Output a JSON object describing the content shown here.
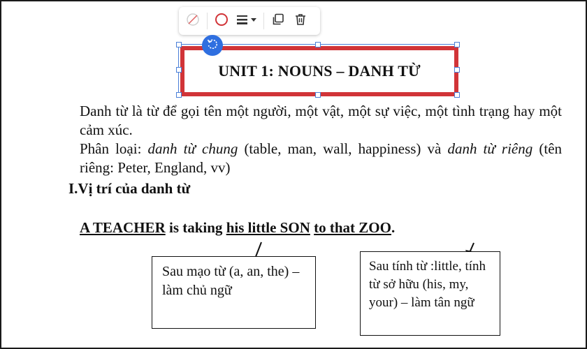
{
  "toolbar": {
    "items": [
      {
        "name": "no-fill-icon"
      },
      {
        "name": "border-color-icon",
        "color": "#d13438"
      },
      {
        "name": "line-style-icon"
      },
      {
        "name": "duplicate-icon"
      },
      {
        "name": "delete-icon"
      }
    ]
  },
  "colors": {
    "accent": "#2f6fe0",
    "shape_border": "#d13438",
    "selection": "#4a7fd8"
  },
  "title_box": {
    "text": "UNIT 1: NOUNS – DANH TỪ"
  },
  "definition": {
    "line1": "Danh từ là từ để gọi tên một người, một vật, một sự việc, một tình trạng hay một cảm xúc.",
    "classify_prefix": "Phân loại: ",
    "classify_common": "danh từ chung",
    "classify_mid": " (table, man, wall, happiness) và ",
    "classify_proper": "danh từ riêng",
    "classify_suffix": " (tên riêng: Peter, England, vv)"
  },
  "section_heading": "I.Vị trí của danh từ",
  "example": {
    "part1": "A TEACHER",
    "part2": " is taking ",
    "part3": "his little SON",
    "part4": " ",
    "part5": "to that ZOO",
    "part6": "."
  },
  "notes": {
    "left": "Sau mạo từ (a, an, the) – làm chủ ngữ",
    "right": "Sau tính từ :little, tính từ sở hữu (his, my, your) – làm tân ngữ"
  }
}
